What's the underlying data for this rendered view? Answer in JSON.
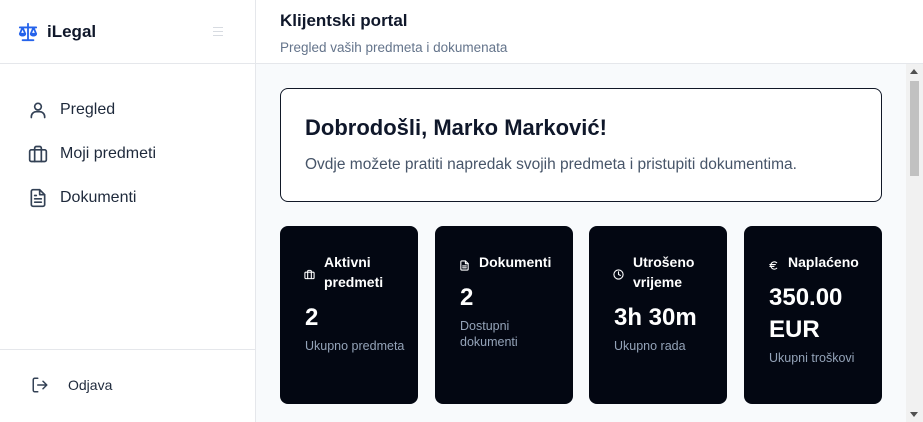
{
  "brand": {
    "name": "iLegal",
    "icon": "scale-icon"
  },
  "sidebar": {
    "items": [
      {
        "label": "Pregled",
        "icon": "user-icon"
      },
      {
        "label": "Moji predmeti",
        "icon": "briefcase-icon"
      },
      {
        "label": "Dokumenti",
        "icon": "file-text-icon"
      }
    ],
    "logout": {
      "label": "Odjava",
      "icon": "logout-icon"
    }
  },
  "header": {
    "title": "Klijentski portal",
    "subtitle": "Pregled vaših predmeta i dokumenata"
  },
  "welcome": {
    "title": "Dobrodošli, Marko Marković!",
    "text": "Ovdje možete pratiti napredak svojih predmeta i pristupiti dokumentima."
  },
  "stats": [
    {
      "title": "Aktivni predmeti",
      "value": "2",
      "sub": "Ukupno predmeta",
      "icon": "briefcase-icon"
    },
    {
      "title": "Dokumenti",
      "value": "2",
      "sub": "Dostupni dokumenti",
      "icon": "file-text-icon"
    },
    {
      "title": "Utrošeno vrijeme",
      "value": "3h 30m",
      "sub": "Ukupno rada",
      "icon": "clock-icon"
    },
    {
      "title": "Naplaćeno",
      "value": "350.00 EUR",
      "sub": "Ukupni troškovi",
      "icon": "euro-icon"
    }
  ],
  "colors": {
    "accent": "#2563eb",
    "card_bg": "#030712",
    "muted": "#64748b",
    "main_bg": "#f8fafc"
  }
}
